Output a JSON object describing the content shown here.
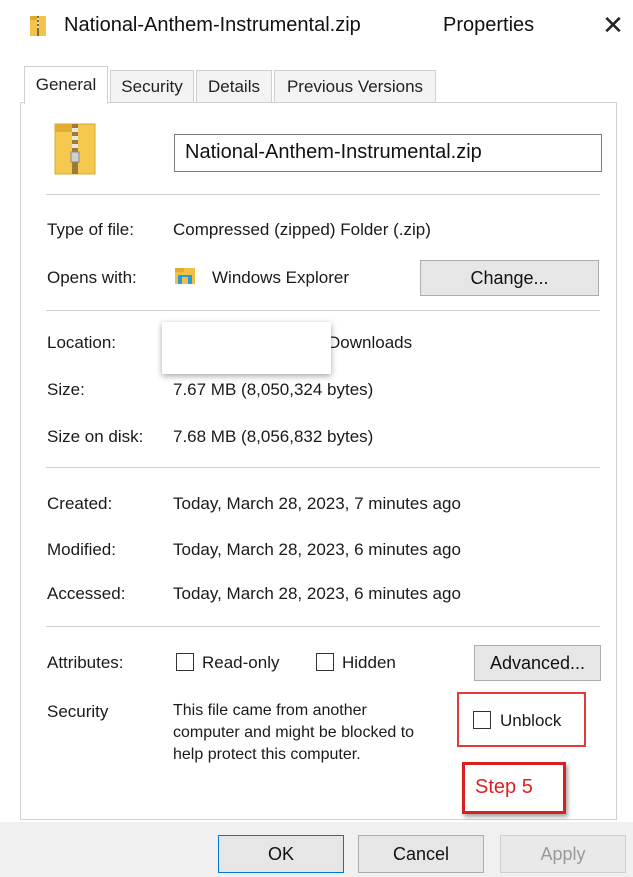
{
  "window": {
    "title": "National-Anthem-Instrumental.zip",
    "title_suffix": "Properties",
    "close_glyph": "✕"
  },
  "tabs": [
    {
      "label": "General",
      "active": true
    },
    {
      "label": "Security",
      "active": false
    },
    {
      "label": "Details",
      "active": false
    },
    {
      "label": "Previous Versions",
      "active": false
    }
  ],
  "general": {
    "file_name_value": "National-Anthem-Instrumental.zip",
    "type_label": "Type of file:",
    "type_value": "Compressed (zipped) Folder (.zip)",
    "opens_label": "Opens with:",
    "opens_value": "Windows Explorer",
    "change_button": "Change...",
    "location_label": "Location:",
    "location_value": "Downloads",
    "size_label": "Size:",
    "size_value": "7.67 MB (8,050,324 bytes)",
    "size_on_disk_label": "Size on disk:",
    "size_on_disk_value": "7.68 MB (8,056,832 bytes)",
    "created_label": "Created:",
    "created_value": "Today, March 28, 2023, 7 minutes ago",
    "modified_label": "Modified:",
    "modified_value": "Today, March 28, 2023, 6 minutes ago",
    "accessed_label": "Accessed:",
    "accessed_value": "Today, March 28, 2023, 6 minutes ago",
    "attributes_label": "Attributes:",
    "readonly_label": "Read-only",
    "hidden_label": "Hidden",
    "advanced_button": "Advanced...",
    "security_label": "Security",
    "security_line1": "This file came from another",
    "security_line2": "computer and might be blocked to",
    "security_line3": "help protect this computer.",
    "unblock_label": "Unblock"
  },
  "annotation": {
    "step_label": "Step 5",
    "color": "#e02020"
  },
  "footer": {
    "ok_button": "OK",
    "cancel_button": "Cancel",
    "apply_button": "Apply"
  },
  "icons": {
    "title": "zip-folder-icon",
    "file": "zip-folder-icon",
    "opens": "windows-explorer-icon"
  }
}
